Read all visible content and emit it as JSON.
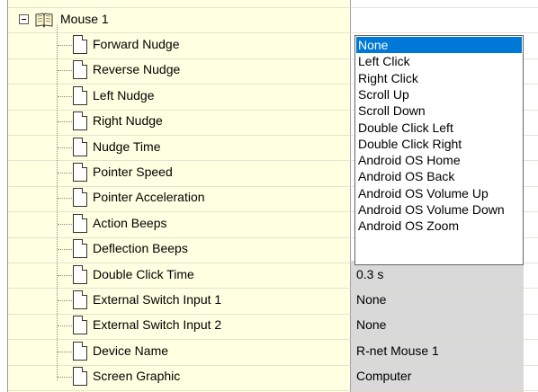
{
  "tree": {
    "root_label": "Mouse 1",
    "items": [
      {
        "label": "Forward Nudge",
        "value": ""
      },
      {
        "label": "Reverse Nudge",
        "value": ""
      },
      {
        "label": "Left Nudge",
        "value": ""
      },
      {
        "label": "Right Nudge",
        "value": ""
      },
      {
        "label": "Nudge Time",
        "value": ""
      },
      {
        "label": "Pointer Speed",
        "value": ""
      },
      {
        "label": "Pointer Acceleration",
        "value": ""
      },
      {
        "label": "Action Beeps",
        "value": ""
      },
      {
        "label": "Deflection Beeps",
        "value": ""
      },
      {
        "label": "Double Click Time",
        "value": "0.3 s"
      },
      {
        "label": "External Switch Input 1",
        "value": "None"
      },
      {
        "label": "External Switch Input 2",
        "value": "None"
      },
      {
        "label": "Device Name",
        "value": "R-net Mouse 1"
      },
      {
        "label": "Screen Graphic",
        "value": "Computer"
      }
    ]
  },
  "dropdown": {
    "selected": "None",
    "options": [
      "None",
      "Left Click",
      "Right Click",
      "Scroll Up",
      "Scroll Down",
      "Double Click Left",
      "Double Click Right",
      "Android OS Home",
      "Android OS Back",
      "Android OS Volume Up",
      "Android OS Volume Down",
      "Android OS Zoom"
    ]
  },
  "colors": {
    "tree_background": "#ffffe1",
    "selection": "#0078d7",
    "readonly_background": "#d9d9d9"
  },
  "icons": {
    "root_collapse": "minus-box-icon",
    "root": "open-book-icon",
    "item": "document-icon"
  }
}
